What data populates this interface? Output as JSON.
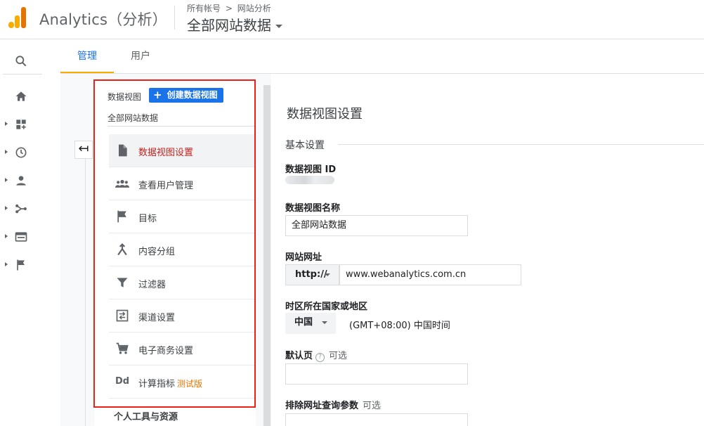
{
  "header": {
    "app_title": "Analytics（分析）",
    "breadcrumb": [
      "所有帐号",
      "网站分析"
    ],
    "breadcrumb_sep": ">",
    "property": "全部网站数据"
  },
  "rail": {
    "items": [
      {
        "icon": "search-icon"
      },
      {
        "icon": "home-icon"
      },
      {
        "icon": "customization-icon"
      },
      {
        "icon": "realtime-clock-icon"
      },
      {
        "icon": "audience-person-icon"
      },
      {
        "icon": "acquisition-icon"
      },
      {
        "icon": "behavior-icon"
      },
      {
        "icon": "conversions-flag-icon"
      }
    ]
  },
  "tabs": [
    {
      "label": "管理",
      "active": true
    },
    {
      "label": "用户",
      "active": false
    }
  ],
  "column": {
    "label": "数据视图",
    "create_button": "创建数据视图",
    "view_name": "全部网站数据",
    "menu": [
      {
        "label": "数据视图设置",
        "icon": "document-icon",
        "active": true
      },
      {
        "label": "查看用户管理",
        "icon": "users-icon",
        "active": false
      },
      {
        "label": "目标",
        "icon": "flag-icon",
        "active": false
      },
      {
        "label": "内容分组",
        "icon": "merge-icon",
        "active": false
      },
      {
        "label": "过滤器",
        "icon": "filter-icon",
        "active": false
      },
      {
        "label": "渠道设置",
        "icon": "channel-icon",
        "active": false
      },
      {
        "label": "电子商务设置",
        "icon": "cart-icon",
        "active": false
      },
      {
        "label": "计算指标",
        "beta": "测试版",
        "icon": "dd-icon",
        "active": false
      }
    ],
    "personal_section": "个人工具与资源"
  },
  "settings": {
    "title": "数据视图设置",
    "section": "基本设置",
    "view_id_label": "数据视图 ID",
    "view_name_label": "数据视图名称",
    "view_name_value": "全部网站数据",
    "url_label": "网站网址",
    "protocol": "http://",
    "url_value": "www.webanalytics.com.cn",
    "tz_label": "时区所在国家或地区",
    "country": "中国",
    "timezone": "(GMT+08:00) 中国时间",
    "default_page_label": "默认页",
    "help_mark": "?",
    "optional": "可选",
    "default_page_value": "",
    "exclude_params_label": "排除网址查询参数",
    "exclude_params_value": ""
  },
  "colors": {
    "accent_blue": "#1a73e8",
    "tab_underline": "#f9ab00",
    "active_item_red": "#c5221f",
    "highlight_box": "#e8221b",
    "beta_orange": "#e37400"
  }
}
